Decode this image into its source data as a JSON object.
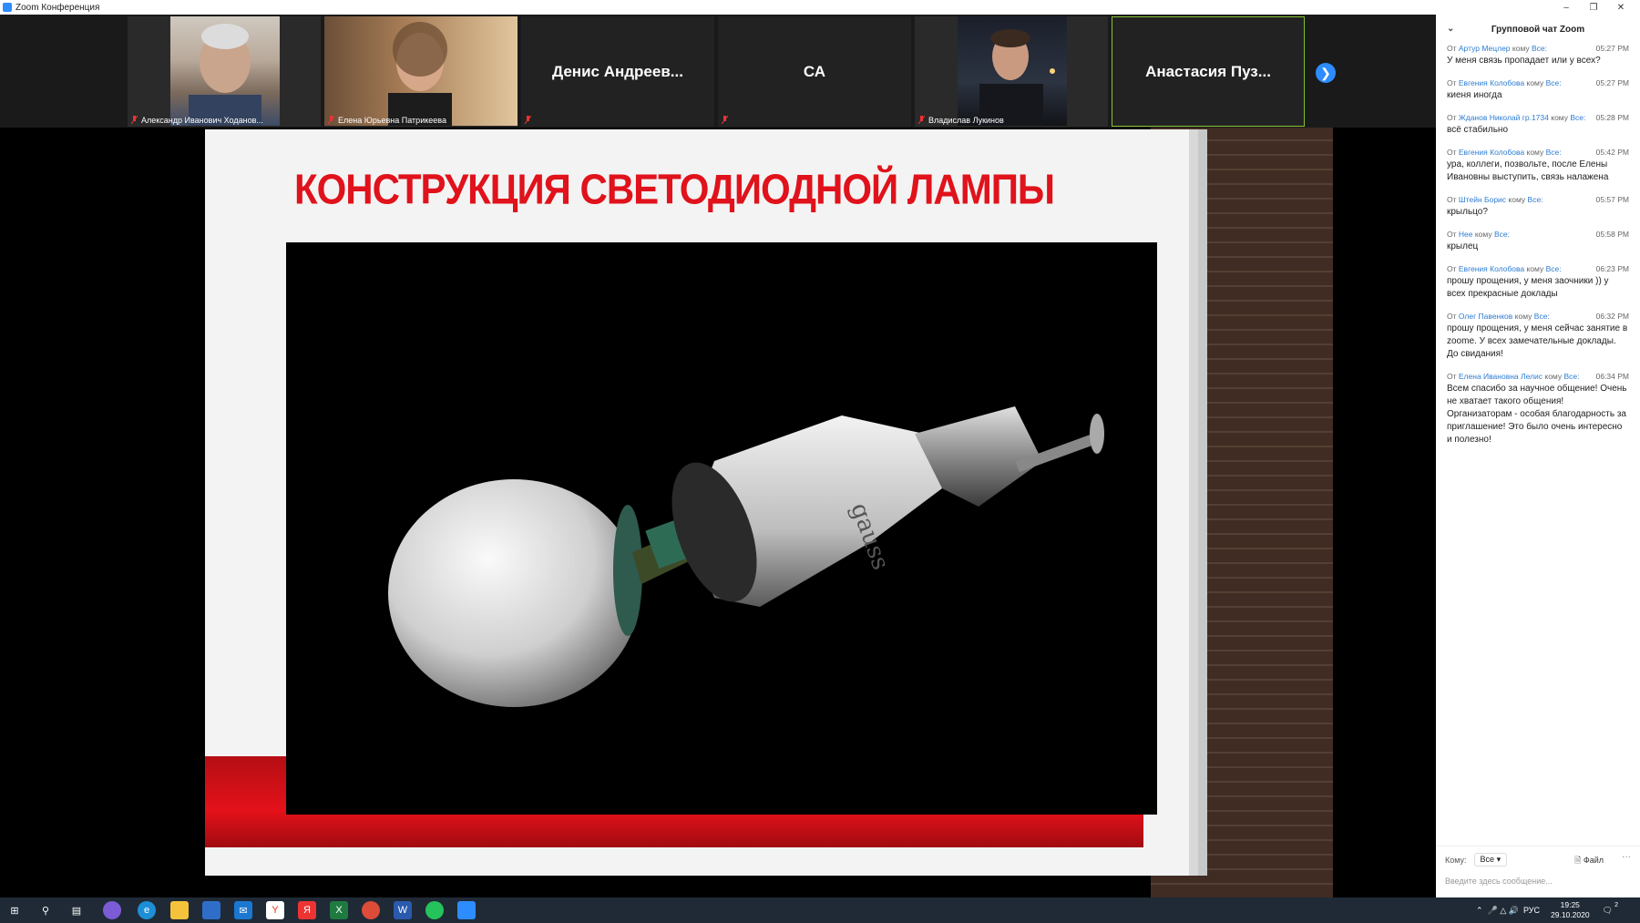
{
  "window": {
    "title": "Zoom Конференция"
  },
  "participants": [
    {
      "name": "Александр Иванович Ходанов..."
    },
    {
      "name": "Елена Юрьевна Патрикеева"
    },
    {
      "display": "Денис  Андреев..."
    },
    {
      "display": "СА"
    },
    {
      "name": "Владислав Лукинов"
    },
    {
      "display": "Анастасия  Пуз..."
    }
  ],
  "slide": {
    "title": "КОНСТРУКЦИЯ СВЕТОДИОДНОЙ ЛАМПЫ",
    "brand": "gauss"
  },
  "chat": {
    "title": "Групповой чат Zoom",
    "messages": [
      {
        "from": "Артур Мецлер",
        "to": "Все:",
        "time": "05:27 PM",
        "text": "У меня связь пропадает или у всех?"
      },
      {
        "from": "Евгения Колобова",
        "to": "Все:",
        "time": "05:27 PM",
        "text": "киеня  иногда"
      },
      {
        "from": "Жданов Николай гр.1734",
        "to": "Все:",
        "time": "05:28 PM",
        "text": "всё стабильно"
      },
      {
        "from": "Евгения Колобова",
        "to": "Все:",
        "time": "05:42 PM",
        "text": "ура, коллеги, позвольте, после Елены Ивановны выступить, связь налажена"
      },
      {
        "from": "Штейн Борис",
        "to": "Все:",
        "time": "05:57 PM",
        "text": "крыльцо?"
      },
      {
        "from": "Нее",
        "to": "Все:",
        "time": "05:58 PM",
        "text": "крылец"
      },
      {
        "from": "Евгения Колобова",
        "to": "Все:",
        "time": "06:23 PM",
        "text": "прошу прощения, у меня заочники )) у всех прекрасные доклады"
      },
      {
        "from": "Олег Павенков",
        "to": "Все:",
        "time": "06:32 PM",
        "text": "прошу прощения, у меня сейчас занятие в zoome. У всех замечательные доклады. До свидания!"
      },
      {
        "from": "Елена Ивановна Лелис",
        "to": "Все:",
        "time": "06:34 PM",
        "text": "Всем спасибо за научное общение! Очень не хватает такого общения! Организаторам - особая благодарность за приглашение! Это было очень интересно и полезно!"
      }
    ],
    "from_word": "От",
    "to_word": "кому",
    "to_label": "Кому:",
    "to_value": "Все",
    "file_label": "Файл",
    "more": "···",
    "input_placeholder": "Введите здесь сообщение..."
  },
  "taskbar": {
    "lang": "РУС",
    "time": "19:25",
    "date": "29.10.2020",
    "notif_count": "2"
  },
  "colors": {
    "accent": "#2d8cff",
    "slide_red": "#e0121b",
    "active_border": "#86c232"
  }
}
